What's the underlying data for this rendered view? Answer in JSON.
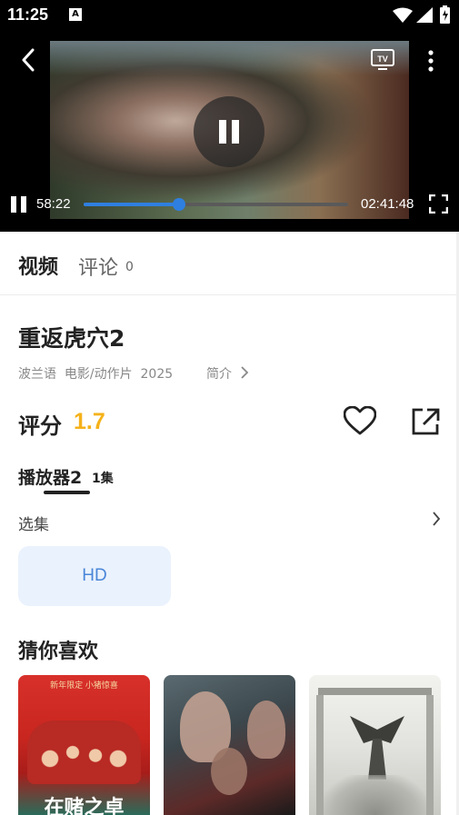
{
  "status_bar": {
    "time": "11:25",
    "notification_badge": "A"
  },
  "player": {
    "current_time": "58:22",
    "total_time": "02:41:48",
    "progress_fraction": 0.36,
    "accent_color": "#2f7fe0",
    "cast_label": "TV"
  },
  "tabs": {
    "video": "视频",
    "comments": "评论",
    "comments_count": "0"
  },
  "movie": {
    "title": "重返虎穴2",
    "meta": "波兰语  电影/动作片  2025",
    "intro_link": "简介",
    "rating_label": "评分",
    "rating_value": "1.7",
    "rating_color": "#f5b21a"
  },
  "player_source": {
    "name": "播放器2",
    "episode_count": "1集"
  },
  "episodes": {
    "label": "选集",
    "items": [
      "HD"
    ]
  },
  "recommendations": {
    "heading": "猜你喜欢",
    "posters": [
      {
        "caption_top": "新年限定 小猪惊喜",
        "caption_bottom": "在赌之卓"
      },
      {
        "caption_top": "",
        "caption_bottom": ""
      },
      {
        "caption_top": "",
        "caption_bottom": ""
      }
    ]
  }
}
